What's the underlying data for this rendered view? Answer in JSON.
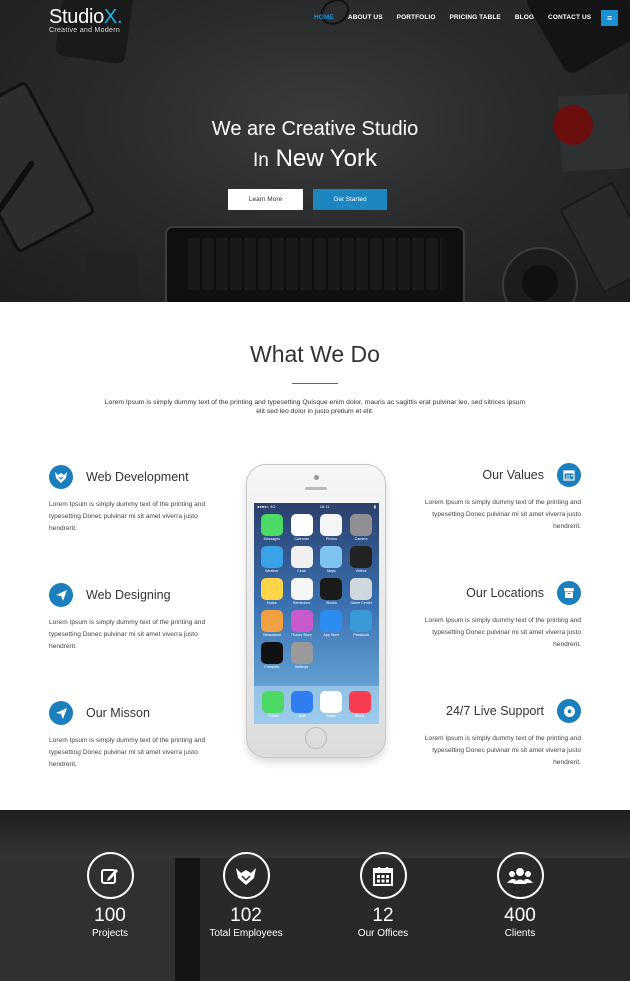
{
  "brand": {
    "name": "Studio",
    "accent": "X.",
    "tagline": "Creative and Modern"
  },
  "nav": [
    "HOME",
    "ABOUT US",
    "PORTFOLIO",
    "PRICING TABLE",
    "BLOG",
    "CONTACT US"
  ],
  "menu_icon": "hamburger-icon",
  "hero": {
    "line1": "We are Creative Studio",
    "line2_prefix": "In",
    "line2_main": "New York",
    "learn_more": "Learn More",
    "get_started": "Get Started"
  },
  "what_we_do": {
    "title": "What We Do",
    "description": "Lorem Ipsum is simply dummy text of the printing and typesetting Quisque enim dolor, mauris ac sagittis erat pulvinar leo, sed sitrices ipsum elit sed leo dolor in justo pretium et elit.",
    "features_left": [
      {
        "title": "Web Development",
        "icon": "fox-icon",
        "desc": "Lorem Ipsum is simply dummy text of the printing and typesetting Donec pulvinar mi sit amet viverra justo hendrerit."
      },
      {
        "title": "Web Designing",
        "icon": "paper-plane-icon",
        "desc": "Lorem Ipsum is simply dummy text of the printing and typesetting Donec pulvinar mi sit amet viverra justo hendrerit."
      },
      {
        "title": "Our Misson",
        "icon": "paper-plane-icon",
        "desc": "Lorem Ipsum is simply dummy text of the printing and typesetting Donec pulvinar mi sit amet viverra justo hendrerit."
      }
    ],
    "features_right": [
      {
        "title": "Our Values",
        "icon": "calendar-icon",
        "desc": "Lorem Ipsum is simply dummy text of the printing and typesetting Donec pulvinar mi sit amet viverra justo hendrerit."
      },
      {
        "title": "Our Locations",
        "icon": "archive-icon",
        "desc": "Lorem Ipsum is simply dummy text of the printing and typesetting Donec pulvinar mi sit amet viverra justo hendrerit."
      },
      {
        "title": "24/7 Live Support",
        "icon": "soccer-ball-icon",
        "desc": "Lorem Ipsum is simply dummy text of the printing and typesetting Donec pulvinar mi sit amet viverra justo hendrerit."
      }
    ]
  },
  "phone": {
    "carrier": "●●●●○ 4G",
    "time": "16:11",
    "apps": [
      "Messages",
      "Calendar",
      "Photos",
      "Camera",
      "Weather",
      "Clock",
      "Maps",
      "Videos",
      "Notes",
      "Reminders",
      "Stocks",
      "Game Center",
      "Newsstand",
      "iTunes Store",
      "App Store",
      "Passbook",
      "Compass",
      "Settings"
    ],
    "dock": [
      "Phone",
      "Mail",
      "Safari",
      "Music"
    ],
    "app_colors": [
      "#4cd964",
      "#ffffff",
      "#f5f5f5",
      "#8e8e93",
      "#3aa3e8",
      "#f0f0f0",
      "#7dc4f0",
      "#222222",
      "#ffd54a",
      "#f6f6f6",
      "#1a1a1a",
      "#cfd8dc",
      "#f0a040",
      "#c85ad0",
      "#2c8df0",
      "#3a9ad8",
      "#111111",
      "#9a9a9a"
    ],
    "dock_colors": [
      "#4cd964",
      "#2f7df0",
      "#ffffff",
      "#fa3c50"
    ]
  },
  "stats": [
    {
      "value": "100",
      "label": "Projects",
      "icon": "pencil-square-icon"
    },
    {
      "value": "102",
      "label": "Total Employees",
      "icon": "fox-icon"
    },
    {
      "value": "12",
      "label": "Our Offices",
      "icon": "calendar-icon"
    },
    {
      "value": "400",
      "label": "Clients",
      "icon": "users-icon"
    }
  ],
  "colors": {
    "accent": "#1b7fbd",
    "button": "#1b86c0",
    "nav_active": "#1b8fd1"
  }
}
